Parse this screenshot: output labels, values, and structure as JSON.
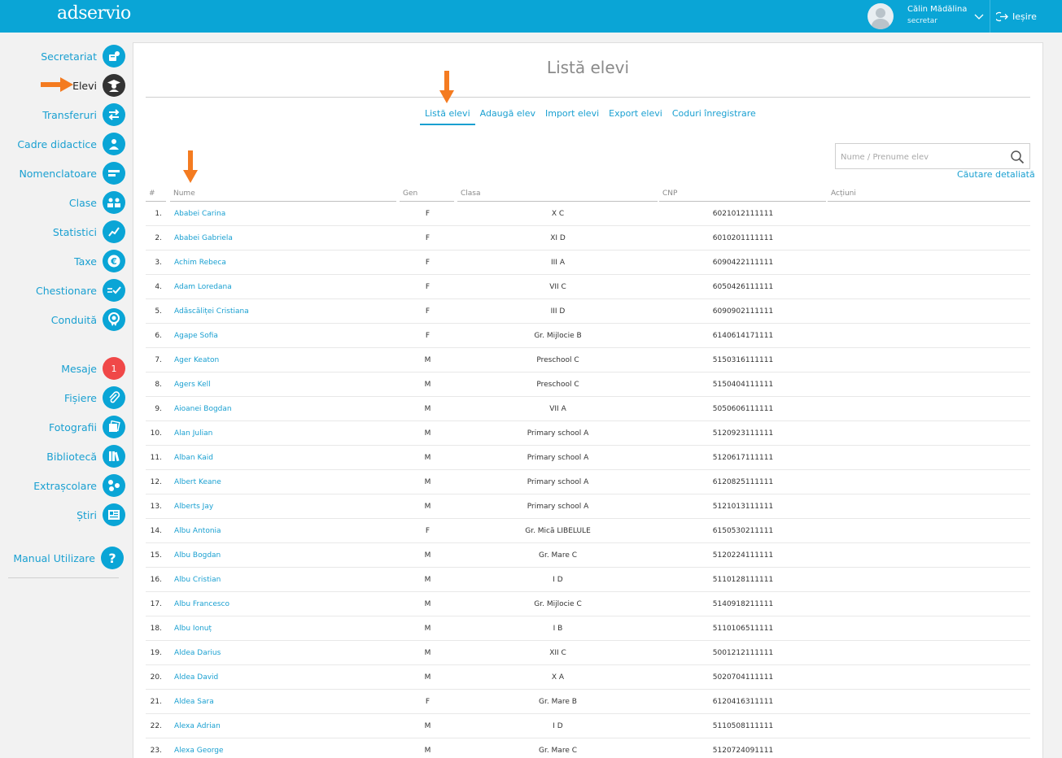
{
  "header": {
    "logo": "adservio",
    "user_name": "Călin Mădălina",
    "user_role": "secretar",
    "logout_label": "Ieșire"
  },
  "sidebar": {
    "items": [
      {
        "label": "Secretariat",
        "icon": "secretariat-icon"
      },
      {
        "label": "Elevi",
        "icon": "graduate-icon",
        "active": true
      },
      {
        "label": "Transferuri",
        "icon": "transfer-arrows-icon"
      },
      {
        "label": "Cadre didactice",
        "icon": "teacher-icon"
      },
      {
        "label": "Nomenclatoare",
        "icon": "list-icon"
      },
      {
        "label": "Clase",
        "icon": "class-group-icon"
      },
      {
        "label": "Statistici",
        "icon": "chart-line-icon"
      },
      {
        "label": "Taxe",
        "icon": "euro-icon"
      },
      {
        "label": "Chestionare",
        "icon": "checklist-icon"
      },
      {
        "label": "Conduită",
        "icon": "medal-icon"
      },
      {
        "label": "Mesaje",
        "icon": "message-badge",
        "badge": "1"
      },
      {
        "label": "Fișiere",
        "icon": "paperclip-icon"
      },
      {
        "label": "Fotografii",
        "icon": "photos-icon"
      },
      {
        "label": "Bibliotecă",
        "icon": "library-icon"
      },
      {
        "label": "Extrașcolare",
        "icon": "activities-icon"
      },
      {
        "label": "Știri",
        "icon": "news-icon"
      },
      {
        "label": "Manual Utilizare",
        "icon": "help-icon"
      }
    ]
  },
  "main": {
    "title": "Listă elevi",
    "tabs": [
      {
        "label": "Listă elevi",
        "active": true
      },
      {
        "label": "Adaugă elev"
      },
      {
        "label": "Import elevi"
      },
      {
        "label": "Export elevi"
      },
      {
        "label": "Coduri înregistrare"
      }
    ],
    "search": {
      "placeholder": "Nume / Prenume elev",
      "value": ""
    },
    "advanced_search": "Căutare detaliată",
    "table": {
      "columns": [
        "#",
        "Nume",
        "Gen",
        "Clasa",
        "CNP",
        "Acțiuni"
      ],
      "rows": [
        [
          "1.",
          "Ababei Carina",
          "F",
          "X C",
          "6021012111111"
        ],
        [
          "2.",
          "Ababei Gabriela",
          "F",
          "XI D",
          "6010201111111"
        ],
        [
          "3.",
          "Achim Rebeca",
          "F",
          "III A",
          "6090422111111"
        ],
        [
          "4.",
          "Adam Loredana",
          "F",
          "VII C",
          "6050426111111"
        ],
        [
          "5.",
          "Adăscăliței Cristiana",
          "F",
          "III D",
          "6090902111111"
        ],
        [
          "6.",
          "Agape Sofia",
          "F",
          "Gr. Mijlocie B",
          "6140614171111"
        ],
        [
          "7.",
          "Ager Keaton",
          "M",
          "Preschool C",
          "5150316111111"
        ],
        [
          "8.",
          "Agers Kell",
          "M",
          "Preschool C",
          "5150404111111"
        ],
        [
          "9.",
          "Aioanei Bogdan",
          "M",
          "VII A",
          "5050606111111"
        ],
        [
          "10.",
          "Alan Julian",
          "M",
          "Primary school A",
          "5120923111111"
        ],
        [
          "11.",
          "Alban Kaid",
          "M",
          "Primary school A",
          "5120617111111"
        ],
        [
          "12.",
          "Albert Keane",
          "M",
          "Primary school A",
          "6120825111111"
        ],
        [
          "13.",
          "Alberts Jay",
          "M",
          "Primary school A",
          "5121013111111"
        ],
        [
          "14.",
          "Albu Antonia",
          "F",
          "Gr. Mică LIBELULE",
          "6150530211111"
        ],
        [
          "15.",
          "Albu Bogdan",
          "M",
          "Gr. Mare C",
          "5120224111111"
        ],
        [
          "16.",
          "Albu Cristian",
          "M",
          "I D",
          "5110128111111"
        ],
        [
          "17.",
          "Albu Francesco",
          "M",
          "Gr. Mijlocie C",
          "5140918211111"
        ],
        [
          "18.",
          "Albu Ionuț",
          "M",
          "I B",
          "5110106511111"
        ],
        [
          "19.",
          "Aldea Darius",
          "M",
          "XII C",
          "5001212111111"
        ],
        [
          "20.",
          "Aldea David",
          "M",
          "X A",
          "5020704111111"
        ],
        [
          "21.",
          "Aldea Sara",
          "F",
          "Gr. Mare B",
          "6120416311111"
        ],
        [
          "22.",
          "Alexa Adrian",
          "M",
          "I D",
          "5110508111111"
        ],
        [
          "23.",
          "Alexa George",
          "M",
          "Gr. Mare C",
          "5120724091111"
        ]
      ]
    }
  },
  "colors": {
    "brand": "#0aa5d6",
    "link": "#1aa0d1",
    "annotation_arrow": "#f47b20",
    "badge": "#f04848"
  }
}
